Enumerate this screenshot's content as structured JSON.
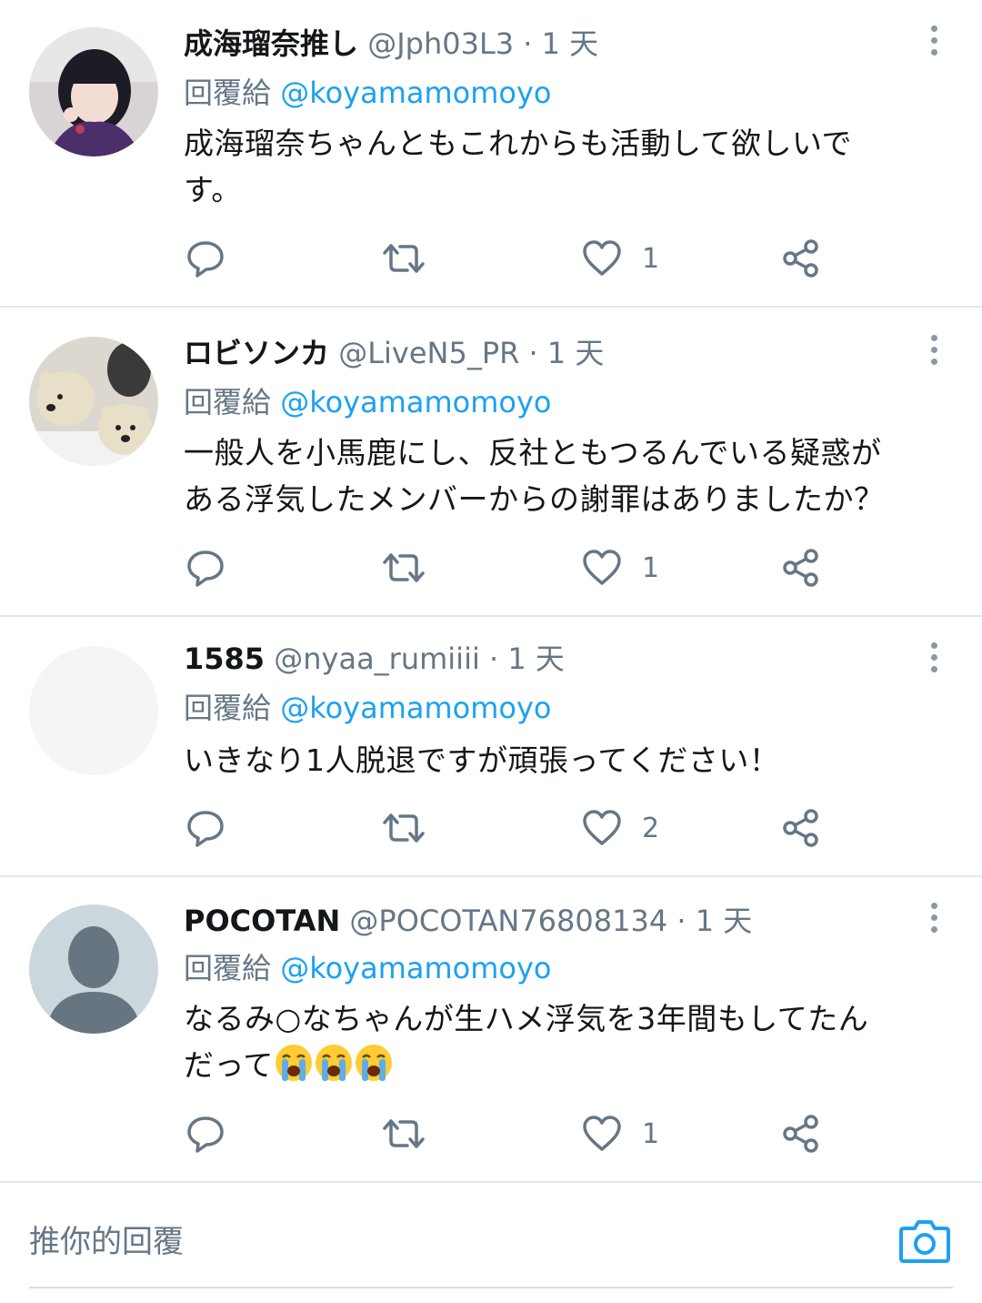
{
  "tweets": [
    {
      "name": "成海瑠奈推し",
      "handle": "@Jph03L3",
      "time": "· 1 天",
      "reply_prefix": "回覆給",
      "reply_mention": "@koyamamomoyo",
      "text_lines": [
        "成海瑠奈ちゃんともこれからも活動して欲しいで",
        "す。"
      ],
      "likes": "1",
      "avatar": "photo-girl"
    },
    {
      "name": "ロビソンカ",
      "handle": "@LiveN5_PR",
      "time": "· 1 天",
      "reply_prefix": "回覆給",
      "reply_mention": "@koyamamomoyo",
      "text_lines": [
        "一般人を小馬鹿にし、反社ともつるんでいる疑惑が",
        "ある浮気したメンバーからの謝罪はありましたか？"
      ],
      "likes": "1",
      "avatar": "photo-polar-bears"
    },
    {
      "name": "1585",
      "handle": "@nyaa_rumiiii",
      "time": "· 1 天",
      "reply_prefix": "回覆給",
      "reply_mention": "@koyamamomoyo",
      "text_lines": [
        "いきなり1人脱退ですが頑張ってください！"
      ],
      "likes": "2",
      "avatar": "blank"
    },
    {
      "name": "POCOTAN",
      "handle": "@POCOTAN76808134",
      "time": "· 1 天",
      "reply_prefix": "回覆給",
      "reply_mention": "@koyamamomoyo",
      "text_lines": [
        "なるみ○なちゃんが生ハメ浮気を3年間もしてたん",
        "だって"
      ],
      "emoji": "loudly-crying-face x3",
      "likes": "1",
      "avatar": "default-person"
    }
  ],
  "composer": {
    "placeholder": "推你的回覆",
    "camera_icon": "camera-icon"
  },
  "colors": {
    "accent": "#1da1f2",
    "secondary_text": "#657786",
    "divider": "#e1e8ed"
  }
}
